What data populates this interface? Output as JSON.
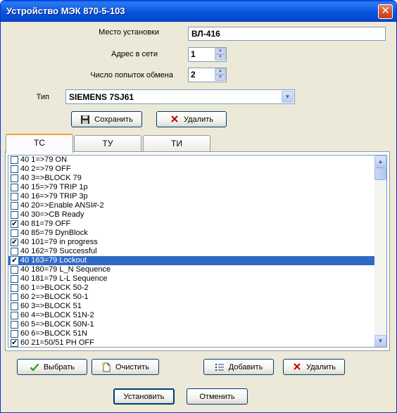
{
  "window": {
    "title": "Устройство МЭК 870-5-103",
    "close_glyph": "✕"
  },
  "form": {
    "location_label": "Место установки",
    "location_value": "ВЛ-416",
    "address_label": "Адрес в сети",
    "address_value": "1",
    "attempts_label": "Число попыток обмена",
    "attempts_value": "2",
    "type_label": "Тип",
    "type_value": "SIEMENS 7SJ61"
  },
  "top_buttons": {
    "save": "Сохранить",
    "delete": "Удалить"
  },
  "tabs": [
    {
      "label": "ТС",
      "active": true
    },
    {
      "label": "ТУ",
      "active": false
    },
    {
      "label": "ТИ",
      "active": false
    }
  ],
  "list": {
    "items": [
      {
        "text": "40 1=>79 ON",
        "checked": false,
        "selected": false
      },
      {
        "text": "40 2=>79 OFF",
        "checked": false,
        "selected": false
      },
      {
        "text": "40 3=>BLOCK 79",
        "checked": false,
        "selected": false
      },
      {
        "text": "40 15=>79 TRIP 1p",
        "checked": false,
        "selected": false
      },
      {
        "text": "40 16=>79 TRIP 3p",
        "checked": false,
        "selected": false
      },
      {
        "text": "40 20=>Enable ANSI#-2",
        "checked": false,
        "selected": false
      },
      {
        "text": "40 30=>CB Ready",
        "checked": false,
        "selected": false
      },
      {
        "text": "40 81=79 OFF",
        "checked": true,
        "selected": false
      },
      {
        "text": "40 85=79 DynBlock",
        "checked": false,
        "selected": false
      },
      {
        "text": "40 101=79 in progress",
        "checked": true,
        "selected": false
      },
      {
        "text": "40 162=79 Successful",
        "checked": false,
        "selected": false
      },
      {
        "text": "40 163=79 Lockout",
        "checked": true,
        "selected": true
      },
      {
        "text": "40 180=79 L_N Sequence",
        "checked": false,
        "selected": false
      },
      {
        "text": "40 181=79 L-L Sequence",
        "checked": false,
        "selected": false
      },
      {
        "text": "60 1=>BLOCK 50-2",
        "checked": false,
        "selected": false
      },
      {
        "text": "60 2=>BLOCK 50-1",
        "checked": false,
        "selected": false
      },
      {
        "text": "60 3=>BLOCK 51",
        "checked": false,
        "selected": false
      },
      {
        "text": "60 4=>BLOCK 51N-2",
        "checked": false,
        "selected": false
      },
      {
        "text": "60 5=>BLOCK 50N-1",
        "checked": false,
        "selected": false
      },
      {
        "text": "60 6=>BLOCK 51N",
        "checked": false,
        "selected": false
      },
      {
        "text": "60 21=50/51 PH OFF",
        "checked": true,
        "selected": false
      }
    ]
  },
  "bottom_buttons": {
    "select": "Выбрать",
    "clear": "Очистить",
    "add": "Добавить",
    "delete": "Удалить"
  },
  "footer_buttons": {
    "install": "Установить",
    "cancel": "Отменить"
  },
  "icons": {
    "save": "floppy-disk-icon",
    "delete": "red-x-icon",
    "select": "green-check-icon",
    "clear": "new-page-icon",
    "add": "bullet-list-icon"
  }
}
